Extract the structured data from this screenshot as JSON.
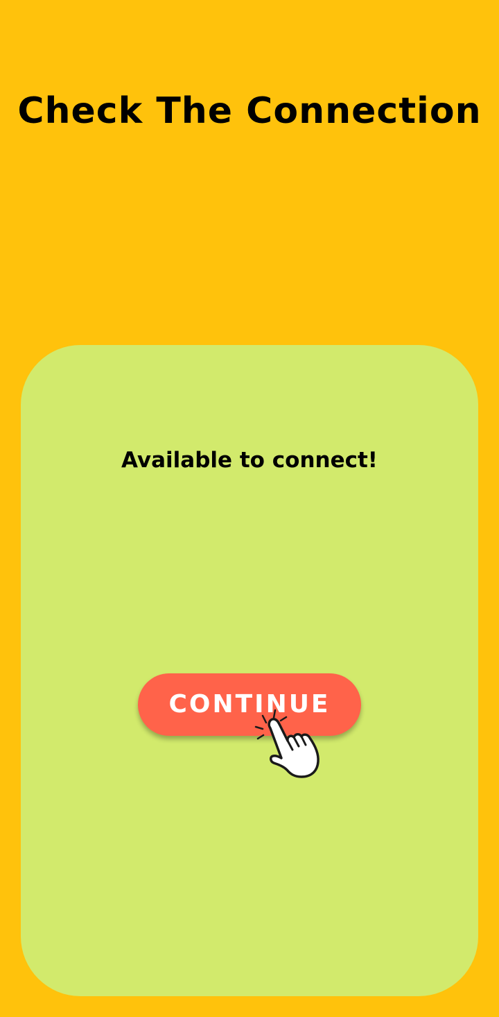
{
  "header": {
    "title": "Check The Connection"
  },
  "card": {
    "status_text": "Available to connect!",
    "continue_label": "CONTINUE",
    "pointer_icon": "tap-hand-icon"
  },
  "colors": {
    "background": "#FFC20C",
    "card": "#D2EA6C",
    "button": "#FF634A",
    "button_text": "#FFFFFF",
    "text": "#000000"
  }
}
